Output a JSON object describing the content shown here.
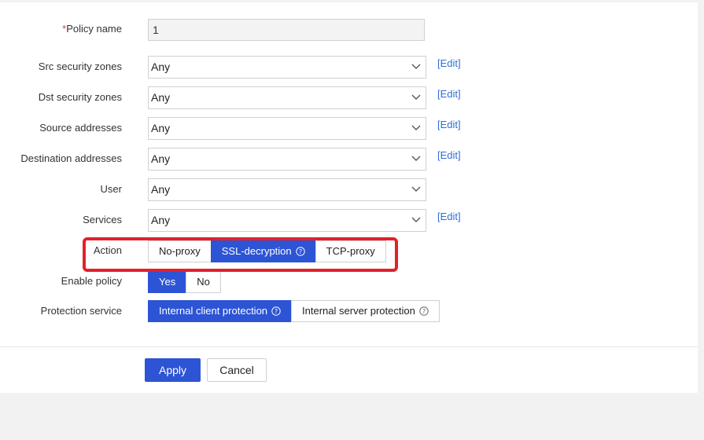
{
  "form": {
    "policy_name": {
      "label": "Policy name",
      "required_mark": "*",
      "value": "1"
    },
    "src_zones": {
      "label": "Src security zones",
      "value": "Any",
      "edit": "[Edit]"
    },
    "dst_zones": {
      "label": "Dst security zones",
      "value": "Any",
      "edit": "[Edit]"
    },
    "src_addresses": {
      "label": "Source addresses",
      "value": "Any",
      "edit": "[Edit]"
    },
    "dst_addresses": {
      "label": "Destination addresses",
      "value": "Any",
      "edit": "[Edit]"
    },
    "user": {
      "label": "User",
      "value": "Any"
    },
    "services": {
      "label": "Services",
      "value": "Any",
      "edit": "[Edit]"
    },
    "action": {
      "label": "Action",
      "options": [
        "No-proxy",
        "SSL-decryption",
        "TCP-proxy"
      ],
      "selected": "SSL-decryption"
    },
    "enable_policy": {
      "label": "Enable policy",
      "options": [
        "Yes",
        "No"
      ],
      "selected": "Yes"
    },
    "protection_service": {
      "label": "Protection service",
      "options": [
        "Internal client protection",
        "Internal server protection"
      ],
      "selected": "Internal client protection"
    }
  },
  "buttons": {
    "apply": "Apply",
    "cancel": "Cancel"
  },
  "colors": {
    "primary": "#2c54d4",
    "highlight": "#e3202a",
    "link": "#2e6dd6",
    "required": "#e03a2f"
  }
}
